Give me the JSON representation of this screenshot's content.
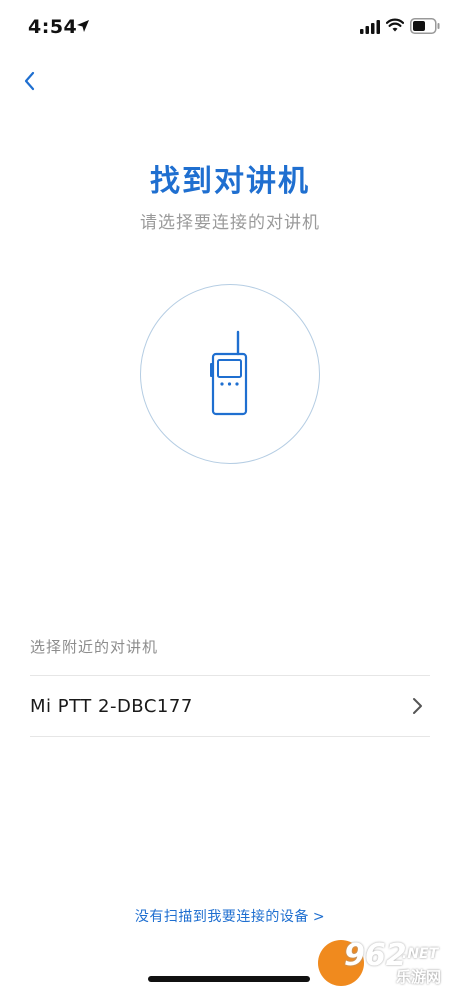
{
  "status_bar": {
    "time": "4:54",
    "icons": [
      "location-arrow-icon",
      "signal-icon",
      "wifi-icon",
      "battery-icon"
    ]
  },
  "nav": {
    "back_icon": "chevron-left-icon"
  },
  "header": {
    "title": "找到对讲机",
    "subtitle": "请选择要连接的对讲机"
  },
  "illustration": {
    "icon": "walkie-talkie-icon"
  },
  "device_list": {
    "section_label": "选择附近的对讲机",
    "items": [
      {
        "name": "Mi PTT 2-DBC177",
        "icon": "chevron-right-icon"
      }
    ]
  },
  "footer": {
    "not_found_link": "没有扫描到我要连接的设备",
    "link_arrow": ">"
  },
  "watermark": {
    "number": "962",
    "suffix": ".NET",
    "site": "乐游网"
  },
  "colors": {
    "accent": "#1f6fd0",
    "circle_border": "#b5cde3",
    "muted_text": "#9a9a9a",
    "divider": "#e6e6e6"
  }
}
